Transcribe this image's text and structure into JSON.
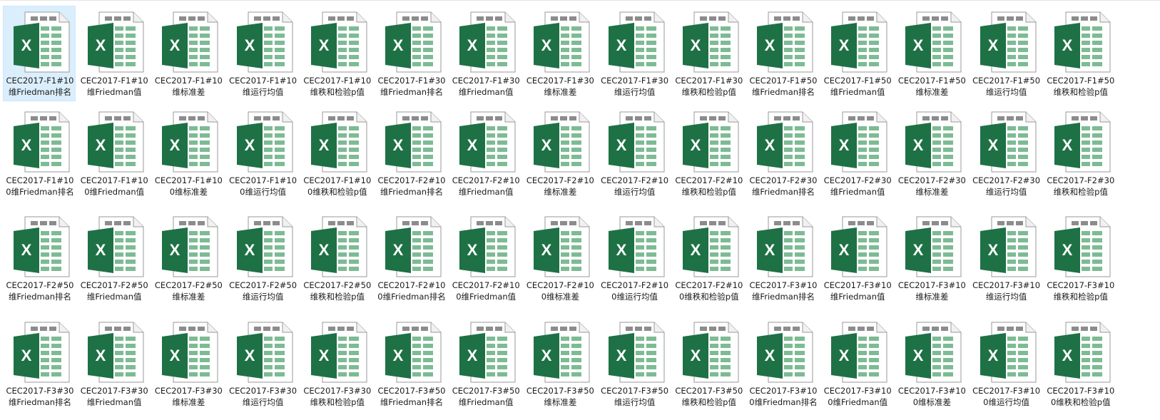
{
  "explorer": {
    "selected_index": 0,
    "files": [
      {
        "name": "CEC2017-F1#10维Friedman排名",
        "icon": "excel-file-icon"
      },
      {
        "name": "CEC2017-F1#10维Friedman值",
        "icon": "excel-file-icon"
      },
      {
        "name": "CEC2017-F1#10维标准差",
        "icon": "excel-file-icon"
      },
      {
        "name": "CEC2017-F1#10维运行均值",
        "icon": "excel-file-icon"
      },
      {
        "name": "CEC2017-F1#10维秩和检验p值",
        "icon": "excel-file-icon"
      },
      {
        "name": "CEC2017-F1#30维Friedman排名",
        "icon": "excel-file-icon"
      },
      {
        "name": "CEC2017-F1#30维Friedman值",
        "icon": "excel-file-icon"
      },
      {
        "name": "CEC2017-F1#30维标准差",
        "icon": "excel-file-icon"
      },
      {
        "name": "CEC2017-F1#30维运行均值",
        "icon": "excel-file-icon"
      },
      {
        "name": "CEC2017-F1#30维秩和检验p值",
        "icon": "excel-file-icon"
      },
      {
        "name": "CEC2017-F1#50维Friedman排名",
        "icon": "excel-file-icon"
      },
      {
        "name": "CEC2017-F1#50维Friedman值",
        "icon": "excel-file-icon"
      },
      {
        "name": "CEC2017-F1#50维标准差",
        "icon": "excel-file-icon"
      },
      {
        "name": "CEC2017-F1#50维运行均值",
        "icon": "excel-file-icon"
      },
      {
        "name": "CEC2017-F1#50维秩和检验p值",
        "icon": "excel-file-icon"
      },
      {
        "name": "CEC2017-F1#100维Friedman排名",
        "icon": "excel-file-icon"
      },
      {
        "name": "CEC2017-F1#100维Friedman值",
        "icon": "excel-file-icon"
      },
      {
        "name": "CEC2017-F1#100维标准差",
        "icon": "excel-file-icon"
      },
      {
        "name": "CEC2017-F1#100维运行均值",
        "icon": "excel-file-icon"
      },
      {
        "name": "CEC2017-F1#100维秩和检验p值",
        "icon": "excel-file-icon"
      },
      {
        "name": "CEC2017-F2#10维Friedman排名",
        "icon": "excel-file-icon"
      },
      {
        "name": "CEC2017-F2#10维Friedman值",
        "icon": "excel-file-icon"
      },
      {
        "name": "CEC2017-F2#10维标准差",
        "icon": "excel-file-icon"
      },
      {
        "name": "CEC2017-F2#10维运行均值",
        "icon": "excel-file-icon"
      },
      {
        "name": "CEC2017-F2#10维秩和检验p值",
        "icon": "excel-file-icon"
      },
      {
        "name": "CEC2017-F2#30维Friedman排名",
        "icon": "excel-file-icon"
      },
      {
        "name": "CEC2017-F2#30维Friedman值",
        "icon": "excel-file-icon"
      },
      {
        "name": "CEC2017-F2#30维标准差",
        "icon": "excel-file-icon"
      },
      {
        "name": "CEC2017-F2#30维运行均值",
        "icon": "excel-file-icon"
      },
      {
        "name": "CEC2017-F2#30维秩和检验p值",
        "icon": "excel-file-icon"
      },
      {
        "name": "CEC2017-F2#50维Friedman排名",
        "icon": "excel-file-icon"
      },
      {
        "name": "CEC2017-F2#50维Friedman值",
        "icon": "excel-file-icon"
      },
      {
        "name": "CEC2017-F2#50维标准差",
        "icon": "excel-file-icon"
      },
      {
        "name": "CEC2017-F2#50维运行均值",
        "icon": "excel-file-icon"
      },
      {
        "name": "CEC2017-F2#50维秩和检验p值",
        "icon": "excel-file-icon"
      },
      {
        "name": "CEC2017-F2#100维Friedman排名",
        "icon": "excel-file-icon"
      },
      {
        "name": "CEC2017-F2#100维Friedman值",
        "icon": "excel-file-icon"
      },
      {
        "name": "CEC2017-F2#100维标准差",
        "icon": "excel-file-icon"
      },
      {
        "name": "CEC2017-F2#100维运行均值",
        "icon": "excel-file-icon"
      },
      {
        "name": "CEC2017-F2#100维秩和检验p值",
        "icon": "excel-file-icon"
      },
      {
        "name": "CEC2017-F3#10维Friedman排名",
        "icon": "excel-file-icon"
      },
      {
        "name": "CEC2017-F3#10维Friedman值",
        "icon": "excel-file-icon"
      },
      {
        "name": "CEC2017-F3#10维标准差",
        "icon": "excel-file-icon"
      },
      {
        "name": "CEC2017-F3#10维运行均值",
        "icon": "excel-file-icon"
      },
      {
        "name": "CEC2017-F3#10维秩和检验p值",
        "icon": "excel-file-icon"
      },
      {
        "name": "CEC2017-F3#30维Friedman排名",
        "icon": "excel-file-icon"
      },
      {
        "name": "CEC2017-F3#30维Friedman值",
        "icon": "excel-file-icon"
      },
      {
        "name": "CEC2017-F3#30维标准差",
        "icon": "excel-file-icon"
      },
      {
        "name": "CEC2017-F3#30维运行均值",
        "icon": "excel-file-icon"
      },
      {
        "name": "CEC2017-F3#30维秩和检验p值",
        "icon": "excel-file-icon"
      },
      {
        "name": "CEC2017-F3#50维Friedman排名",
        "icon": "excel-file-icon"
      },
      {
        "name": "CEC2017-F3#50维Friedman值",
        "icon": "excel-file-icon"
      },
      {
        "name": "CEC2017-F3#50维标准差",
        "icon": "excel-file-icon"
      },
      {
        "name": "CEC2017-F3#50维运行均值",
        "icon": "excel-file-icon"
      },
      {
        "name": "CEC2017-F3#50维秩和检验p值",
        "icon": "excel-file-icon"
      },
      {
        "name": "CEC2017-F3#100维Friedman排名",
        "icon": "excel-file-icon"
      },
      {
        "name": "CEC2017-F3#100维Friedman值",
        "icon": "excel-file-icon"
      },
      {
        "name": "CEC2017-F3#100维标准差",
        "icon": "excel-file-icon"
      },
      {
        "name": "CEC2017-F3#100维运行均值",
        "icon": "excel-file-icon"
      },
      {
        "name": "CEC2017-F3#100维秩和检验p值",
        "icon": "excel-file-icon"
      }
    ]
  },
  "colors": {
    "excel_green": "#1e7145",
    "sheet_green": "#7dbb94",
    "header_gray": "#8c8c8c",
    "selection_bg": "#dbeefc"
  }
}
